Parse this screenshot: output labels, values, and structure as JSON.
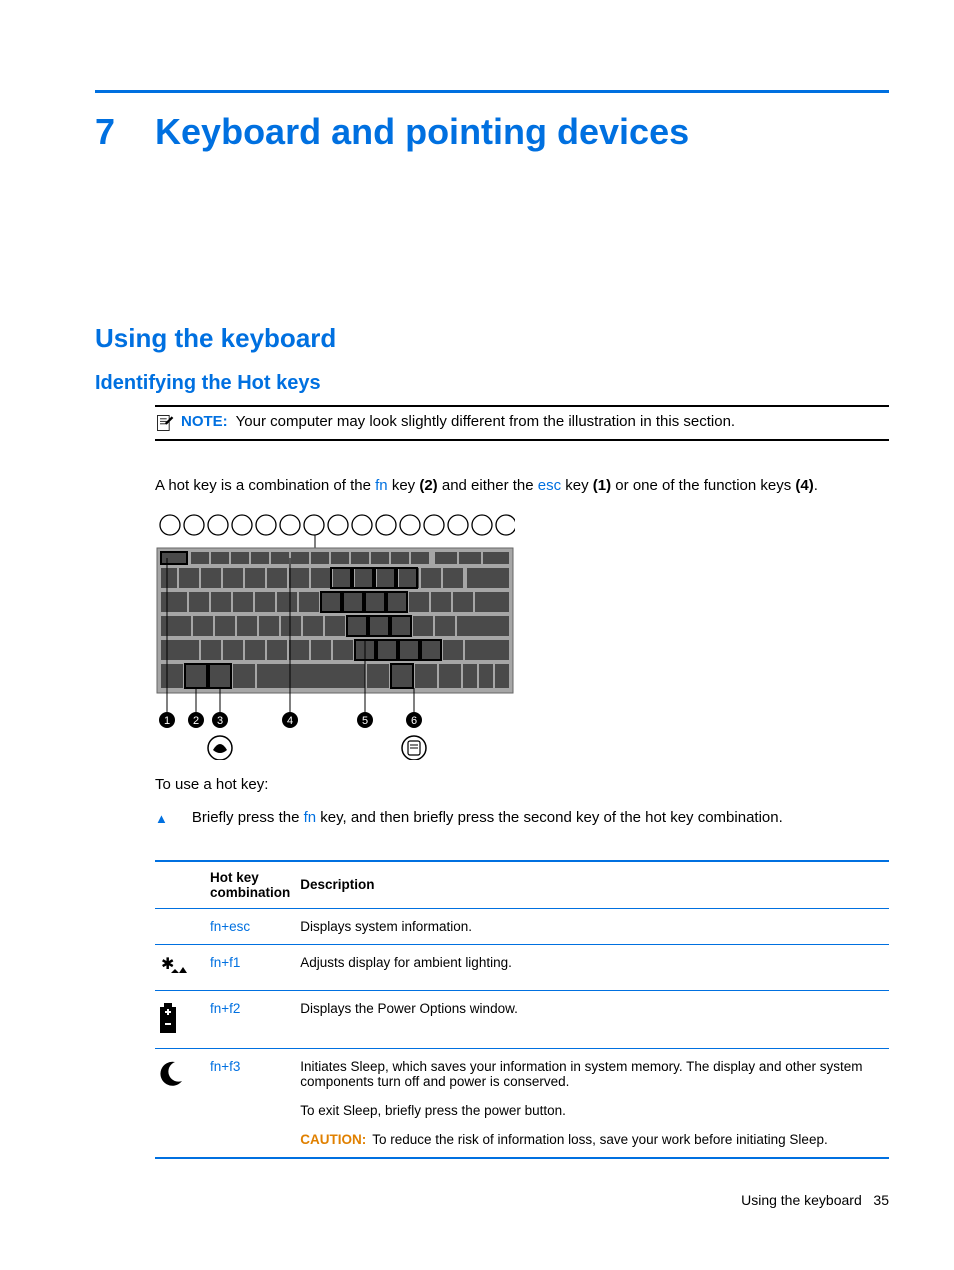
{
  "chapter": {
    "number": "7",
    "title": "Keyboard and pointing devices"
  },
  "section": {
    "title": "Using the keyboard"
  },
  "subsection": {
    "title": "Identifying the Hot keys"
  },
  "note": {
    "label": "NOTE:",
    "text": "Your computer may look slightly different from the illustration in this section."
  },
  "intro": {
    "pre": "A hot key is a combination of the ",
    "fn": "fn",
    "mid1": " key ",
    "b2": "(2)",
    "mid2": " and either the ",
    "esc": "esc",
    "mid3": " key ",
    "b1": "(1)",
    "mid4": " or one of the function keys ",
    "b4": "(4)",
    "end": "."
  },
  "use_hotkey_label": "To use a hot key:",
  "bullet": {
    "pre": "Briefly press the ",
    "fn": "fn",
    "post": " key, and then briefly press the second key of the hot key combination."
  },
  "table": {
    "headers": {
      "combo": "Hot key combination",
      "desc": "Description"
    },
    "rows": [
      {
        "icon": "",
        "fn": "fn",
        "plus": "+",
        "key": "esc",
        "desc": [
          "Displays system information."
        ]
      },
      {
        "icon": "ambient",
        "fn": "fn",
        "plus": "+",
        "key": "f1",
        "desc": [
          "Adjusts display for ambient lighting."
        ]
      },
      {
        "icon": "battery",
        "fn": "fn",
        "plus": "+",
        "key": "f2",
        "desc": [
          "Displays the Power Options window."
        ]
      },
      {
        "icon": "moon",
        "fn": "fn",
        "plus": "+",
        "key": "f3",
        "desc": [
          "Initiates Sleep, which saves your information in system memory. The display and other system components turn off and power is conserved.",
          "To exit Sleep, briefly press the power button."
        ],
        "caution_label": "CAUTION:",
        "caution_text": "To reduce the risk of information loss, save your work before initiating Sleep."
      }
    ]
  },
  "footer": {
    "text": "Using the keyboard",
    "page": "35"
  }
}
